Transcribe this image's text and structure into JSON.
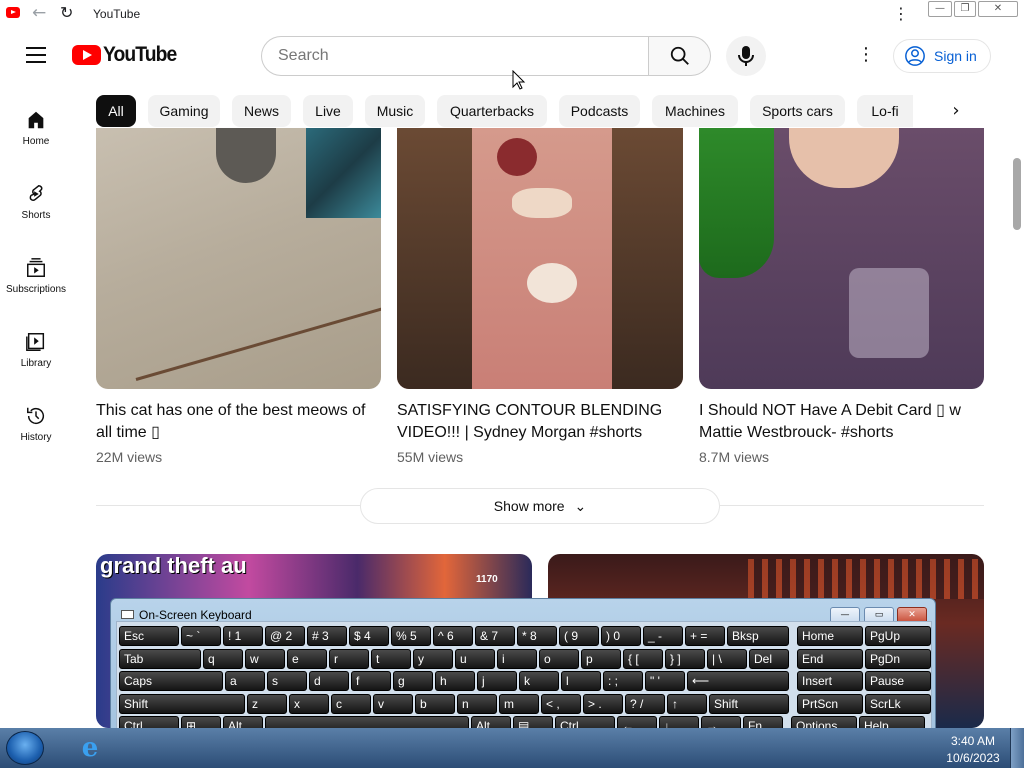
{
  "browser": {
    "tab_title": "YouTube",
    "window_controls": {
      "minimize": "—",
      "maximize": "❐",
      "close": "✕"
    }
  },
  "header": {
    "logo_text": "YouTube",
    "search_placeholder": "Search",
    "sign_in": "Sign in"
  },
  "chips": [
    "All",
    "Gaming",
    "News",
    "Live",
    "Music",
    "Quarterbacks",
    "Podcasts",
    "Machines",
    "Sports cars",
    "Lo-fi"
  ],
  "sidebar": [
    {
      "label": "Home",
      "icon": "home-icon"
    },
    {
      "label": "Shorts",
      "icon": "shorts-icon"
    },
    {
      "label": "Subscriptions",
      "icon": "subscriptions-icon"
    },
    {
      "label": "Library",
      "icon": "library-icon"
    },
    {
      "label": "History",
      "icon": "history-icon"
    }
  ],
  "videos": [
    {
      "title": "This cat has one of the best meows of all time ▯",
      "views": "22M views"
    },
    {
      "title": "SATISFYING CONTOUR BLENDING VIDEO!!! | Sydney Morgan #shorts",
      "views": "55M views"
    },
    {
      "title": "I Should NOT Have A Debit Card ▯ w Mattie Westbrouck- #shorts",
      "views": "8.7M views"
    }
  ],
  "show_more": "Show more",
  "second_row_overlay": {
    "left_text": "grand theft au",
    "counter": "1170"
  },
  "osk": {
    "title": "On-Screen Keyboard",
    "rows": [
      [
        [
          "Esc",
          ""
        ],
        [
          "~ `",
          ""
        ],
        [
          "! 1",
          ""
        ],
        [
          "@ 2",
          ""
        ],
        [
          "# 3",
          ""
        ],
        [
          "$ 4",
          ""
        ],
        [
          "% 5",
          ""
        ],
        [
          "^ 6",
          ""
        ],
        [
          "& 7",
          ""
        ],
        [
          "* 8",
          ""
        ],
        [
          "( 9",
          ""
        ],
        [
          ") 0",
          ""
        ],
        [
          "_ -",
          ""
        ],
        [
          "+ =",
          ""
        ],
        [
          "Bksp",
          ""
        ],
        [
          "Home",
          ""
        ],
        [
          "PgUp",
          ""
        ]
      ],
      [
        [
          "Tab",
          ""
        ],
        [
          "q",
          ""
        ],
        [
          "w",
          ""
        ],
        [
          "e",
          ""
        ],
        [
          "r",
          ""
        ],
        [
          "t",
          ""
        ],
        [
          "y",
          ""
        ],
        [
          "u",
          ""
        ],
        [
          "i",
          ""
        ],
        [
          "o",
          ""
        ],
        [
          "p",
          ""
        ],
        [
          "{ [",
          ""
        ],
        [
          "} ]",
          ""
        ],
        [
          "| \\",
          ""
        ],
        [
          "Del",
          ""
        ],
        [
          "End",
          ""
        ],
        [
          "PgDn",
          ""
        ]
      ],
      [
        [
          "Caps",
          ""
        ],
        [
          "a",
          ""
        ],
        [
          "s",
          ""
        ],
        [
          "d",
          ""
        ],
        [
          "f",
          ""
        ],
        [
          "g",
          ""
        ],
        [
          "h",
          ""
        ],
        [
          "j",
          ""
        ],
        [
          "k",
          ""
        ],
        [
          "l",
          ""
        ],
        [
          ": ;",
          ""
        ],
        [
          "\" '",
          ""
        ],
        [
          "⟵",
          ""
        ],
        [
          "Insert",
          ""
        ],
        [
          "Pause",
          ""
        ]
      ],
      [
        [
          "Shift",
          ""
        ],
        [
          "z",
          ""
        ],
        [
          "x",
          ""
        ],
        [
          "c",
          ""
        ],
        [
          "v",
          ""
        ],
        [
          "b",
          ""
        ],
        [
          "n",
          ""
        ],
        [
          "m",
          ""
        ],
        [
          "< ,",
          ""
        ],
        [
          "> .",
          ""
        ],
        [
          "? /",
          ""
        ],
        [
          "↑",
          ""
        ],
        [
          "Shift",
          ""
        ],
        [
          "PrtScn",
          ""
        ],
        [
          "ScrLk",
          ""
        ]
      ],
      [
        [
          "Ctrl",
          ""
        ],
        [
          "⊞",
          ""
        ],
        [
          "Alt",
          ""
        ],
        [
          "",
          ""
        ],
        [
          "Alt",
          ""
        ],
        [
          "▤",
          ""
        ],
        [
          "Ctrl",
          ""
        ],
        [
          "←",
          ""
        ],
        [
          "↓",
          ""
        ],
        [
          "→",
          ""
        ],
        [
          "Fn",
          ""
        ],
        [
          "Options",
          ""
        ],
        [
          "Help",
          ""
        ]
      ]
    ]
  },
  "taskbar": {
    "time": "3:40 AM",
    "date": "10/6/2023"
  },
  "colors": {
    "brand_red": "#ff0000",
    "link_blue": "#065fd4",
    "chip_bg": "#f2f2f2"
  }
}
